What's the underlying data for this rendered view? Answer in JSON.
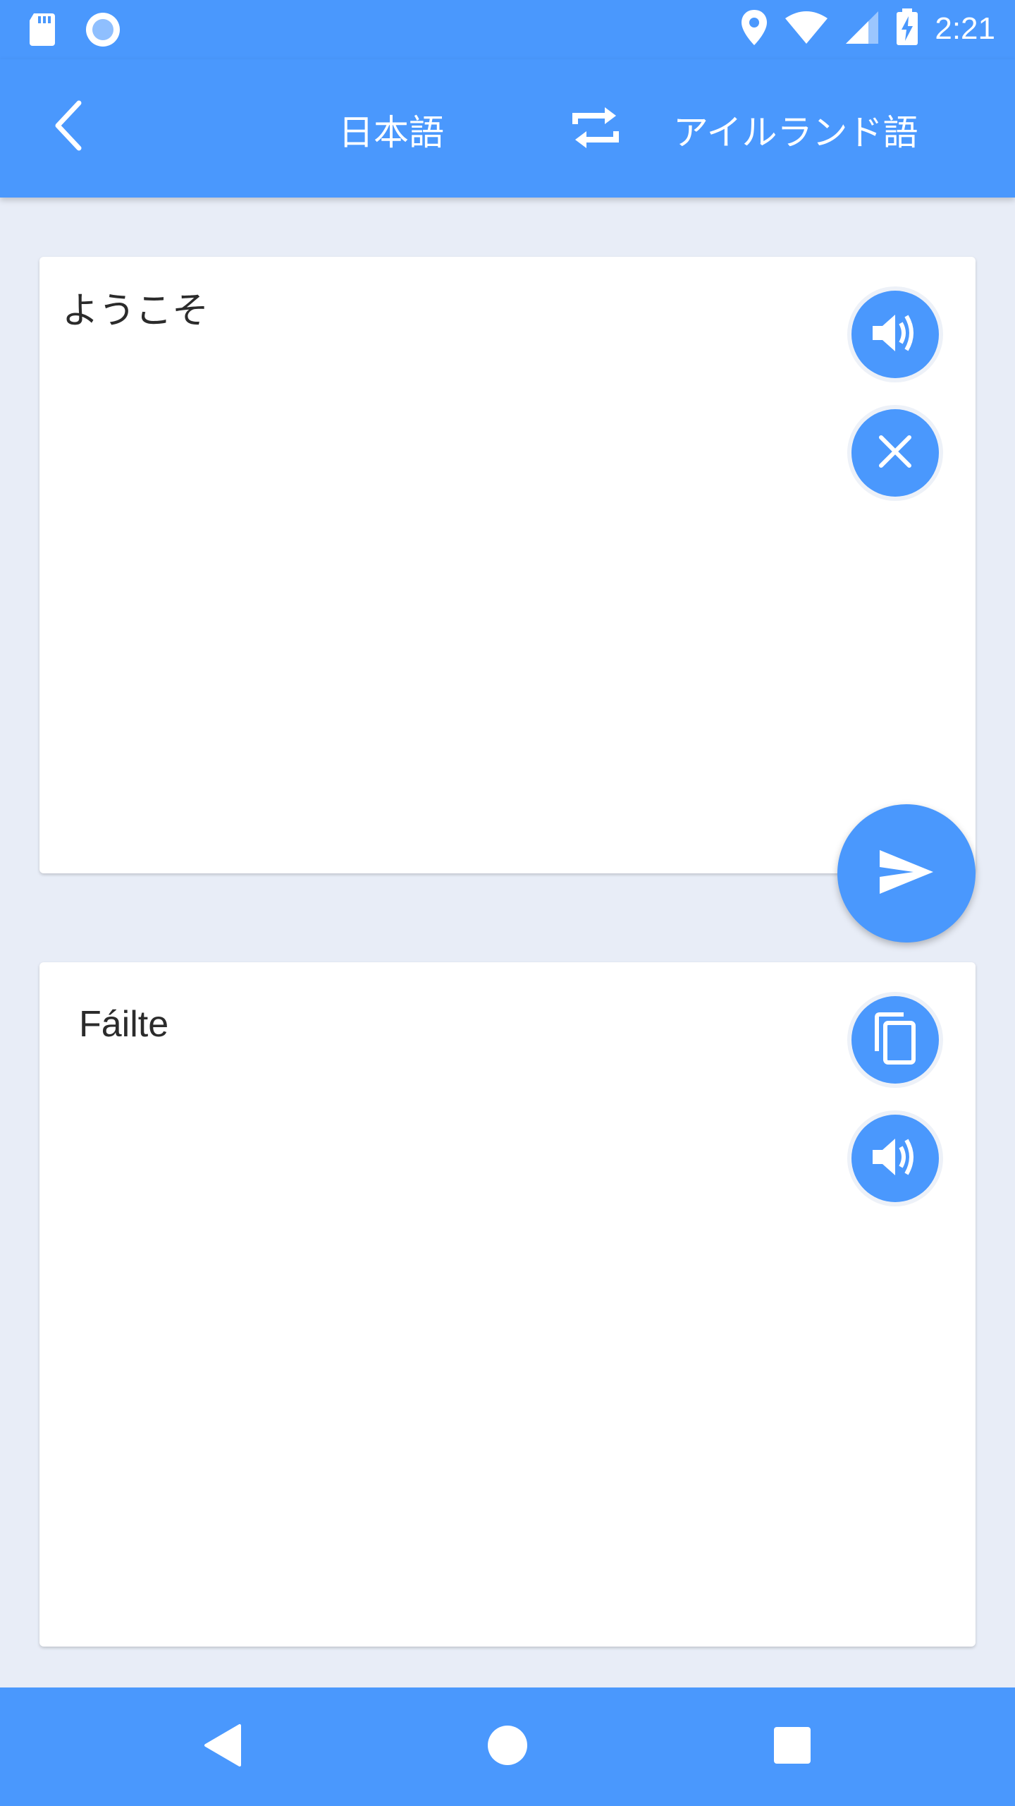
{
  "status_bar": {
    "time": "2:21",
    "left_icons": [
      "sd-card-icon",
      "record-icon"
    ],
    "right_icons": [
      "location-icon",
      "wifi-icon",
      "signal-icon",
      "battery-charging-icon"
    ]
  },
  "app_bar": {
    "source_language": "日本語",
    "target_language": "アイルランド語",
    "back_icon": "chevron-left-icon",
    "swap_icon": "swap-icon"
  },
  "source_panel": {
    "text": "ようこそ",
    "buttons": [
      "speaker-icon",
      "close-icon"
    ],
    "translate_icon": "send-icon"
  },
  "target_panel": {
    "text": "Fáilte",
    "buttons": [
      "copy-icon",
      "speaker-icon"
    ]
  },
  "nav_bar": {
    "icons": [
      "back-triangle-icon",
      "home-circle-icon",
      "recents-square-icon"
    ]
  },
  "colors": {
    "primary": "#4A98FD",
    "background": "#E8EDF7",
    "card": "#FFFFFF",
    "text": "#2B2B2B"
  }
}
